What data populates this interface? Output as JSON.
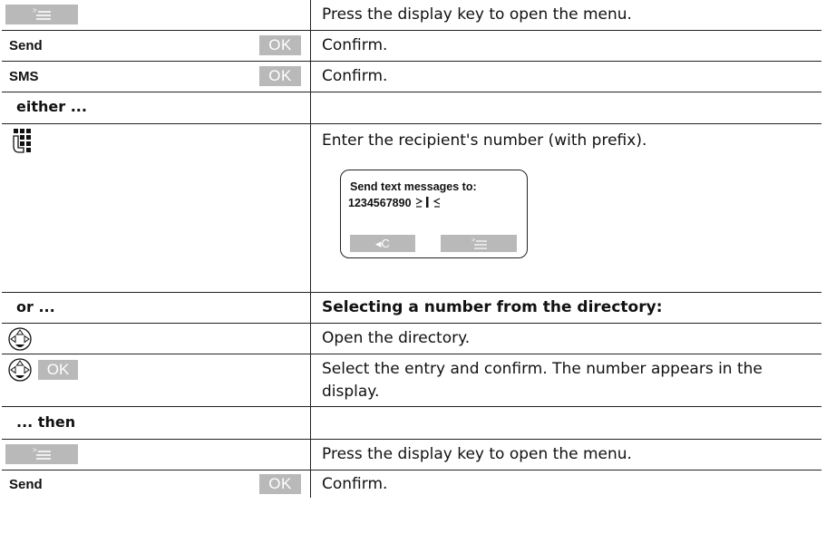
{
  "rows": [
    {
      "key": "menu",
      "text": "Press the display key to open the menu."
    },
    {
      "label": "Send",
      "key": "OK",
      "text": "Confirm."
    },
    {
      "label": "SMS",
      "key": "OK",
      "text": "Confirm."
    },
    {
      "section": "either ...",
      "text": ""
    },
    {
      "icon": "keypad-icon",
      "text": "Enter the recipient's number (with prefix)."
    },
    {
      "section": "or ...",
      "text": "Selecting a number from the directory:"
    },
    {
      "icon": "navigation-key-icon",
      "text": "Open the directory."
    },
    {
      "icon": "navigation-key-icon",
      "key": "OK",
      "text": "Select the entry and confirm. The number appears in the display."
    },
    {
      "section": "... then",
      "text": ""
    },
    {
      "key": "menu",
      "text": "Press the display key to open the menu."
    },
    {
      "label": "Send",
      "key": "OK",
      "text": "Confirm."
    }
  ],
  "display": {
    "line1": "Send text messages to:",
    "line2": "1234567890",
    "softkey_left": "◂C"
  },
  "colors": {
    "key_bg": "#b9b9b9",
    "border": "#222222"
  }
}
